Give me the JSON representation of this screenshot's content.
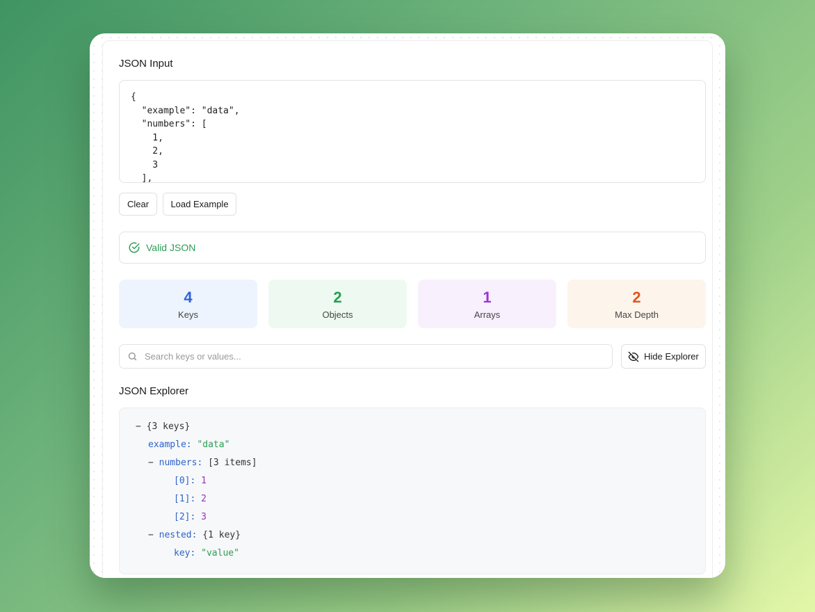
{
  "input_section": {
    "title": "JSON Input",
    "code": "{\n  \"example\": \"data\",\n  \"numbers\": [\n    1,\n    2,\n    3\n  ],"
  },
  "buttons": {
    "clear": "Clear",
    "load_example": "Load Example",
    "hide_explorer": "Hide Explorer"
  },
  "validation": {
    "message": "Valid JSON",
    "color": "#2e9b55"
  },
  "stats": [
    {
      "value": "4",
      "label": "Keys",
      "color": "#2f63d6",
      "bg": "#eef4fd"
    },
    {
      "value": "2",
      "label": "Objects",
      "color": "#23a04e",
      "bg": "#eefaf1"
    },
    {
      "value": "1",
      "label": "Arrays",
      "color": "#9b35d6",
      "bg": "#f8f1fd"
    },
    {
      "value": "2",
      "label": "Max Depth",
      "color": "#e0561d",
      "bg": "#fdf4ec"
    }
  ],
  "search": {
    "placeholder": "Search keys or values..."
  },
  "explorer": {
    "title": "JSON Explorer",
    "root": {
      "toggle": "−",
      "summary": "{3 keys}"
    },
    "example": {
      "key": "example",
      "value": "\"data\""
    },
    "numbers": {
      "toggle": "−",
      "key": "numbers",
      "summary": "[3 items]",
      "items": [
        {
          "key": "[0]",
          "value": "1"
        },
        {
          "key": "[1]",
          "value": "2"
        },
        {
          "key": "[2]",
          "value": "3"
        }
      ]
    },
    "nested": {
      "toggle": "−",
      "key": "nested",
      "summary": "{1 key}",
      "child": {
        "key": "key",
        "value": "\"value\""
      }
    }
  }
}
